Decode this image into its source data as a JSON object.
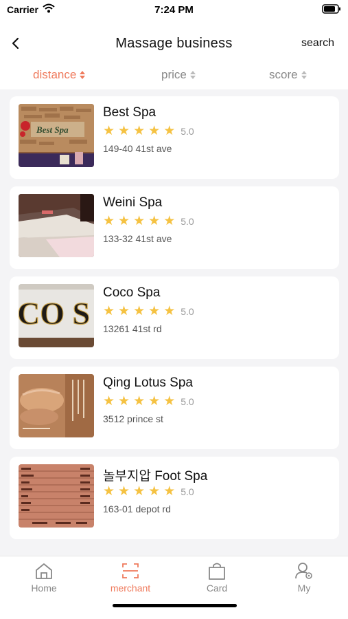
{
  "status_bar": {
    "carrier": "Carrier",
    "time": "7:24 PM"
  },
  "nav": {
    "title": "Massage business",
    "search_label": "search"
  },
  "sort": [
    {
      "label": "distance",
      "active": true
    },
    {
      "label": "price",
      "active": false
    },
    {
      "label": "score",
      "active": false
    }
  ],
  "businesses": [
    {
      "name": "Best Spa",
      "rating": 5,
      "score": "5.0",
      "address": "149-40 41st ave",
      "photo": "spa-wall"
    },
    {
      "name": "Weini Spa",
      "rating": 5,
      "score": "5.0",
      "address": "133-32 41st ave",
      "photo": "massage-beds"
    },
    {
      "name": "Coco Spa",
      "rating": 5,
      "score": "5.0",
      "address": "13261 41st rd",
      "photo": "storefront-sign"
    },
    {
      "name": "Qing Lotus Spa",
      "rating": 5,
      "score": "5.0",
      "address": "3512 prince st",
      "photo": "massage-hands"
    },
    {
      "name": "놀부지압 Foot Spa",
      "rating": 5,
      "score": "5.0",
      "address": "163-01 depot rd",
      "photo": "price-menu"
    }
  ],
  "tabs": [
    {
      "label": "Home",
      "icon": "home-icon",
      "active": false
    },
    {
      "label": "merchant",
      "icon": "scan-icon",
      "active": true
    },
    {
      "label": "Card",
      "icon": "shopping-bag-icon",
      "active": false
    },
    {
      "label": "My",
      "icon": "user-settings-icon",
      "active": false
    }
  ],
  "colors": {
    "accent": "#ef7a5c",
    "star": "#f5c242"
  }
}
